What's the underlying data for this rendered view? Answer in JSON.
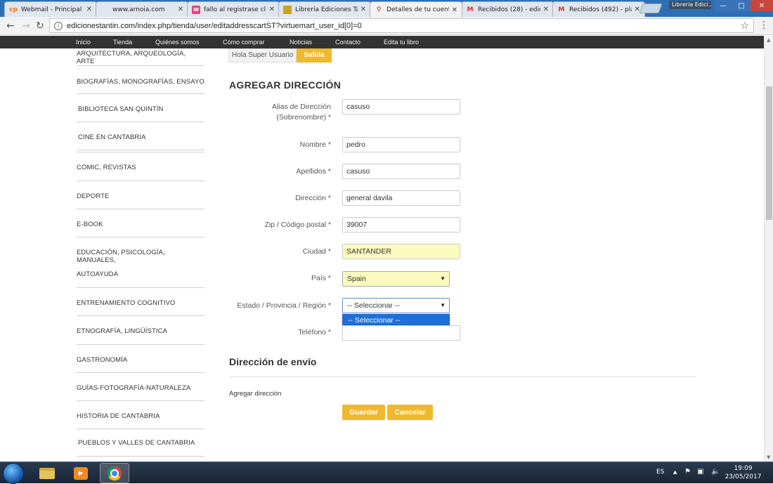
{
  "browser": {
    "tabs": [
      {
        "label": "Webmail - Principal",
        "favicon": "cp"
      },
      {
        "label": "www.arnoia.com",
        "favicon": ""
      },
      {
        "label": "fallo al registrase cl",
        "favicon": "w"
      },
      {
        "label": "Librería Ediciones Ta",
        "favicon": "sq"
      },
      {
        "label": "Detalles de tu cuent",
        "favicon": "pin"
      },
      {
        "label": "Recibidos (28) - edic",
        "favicon": "M"
      },
      {
        "label": "Recibidos (492) - pla",
        "favicon": "M"
      }
    ],
    "profile": "Libreria Edici...",
    "url": "edicionestantin.com/index.php/tienda/user/editaddresscartST?virtuemart_user_id[0]=0"
  },
  "site_nav": [
    "Inicio",
    "Tienda",
    "Quiénes somos",
    "Cómo comprar",
    "Noticias",
    "Contacto",
    "Edita tu libro"
  ],
  "categories": [
    "ARQUITECTURA, ARQUEOLOGÍA, ARTE",
    "BIOGRAFÍAS, MONOGRAFÍAS, ENSAYO",
    "BIBLIOTECA SAN QUINTÍN",
    "CINE EN CANTABRIA",
    "CÓMIC, REVISTAS",
    "DEPORTE",
    "E-BOOK",
    "EDUCACIÓN, PSICOLOGÍA, MANUALES,",
    "AUTOAYUDA",
    "ENTRENAMIENTO COGNITIVO",
    "ETNOGRAFÍA, LINGÜÍSTICA",
    "GASTRONOMÍA",
    "GUÍAS-FOTOGRAFÍA-NATURALEZA",
    "HISTORIA DE CANTABRIA",
    "PUEBLOS Y VALLES DE CANTABRIA"
  ],
  "user": {
    "greeting": "Hola Super Usuario",
    "logout_label": "Salida"
  },
  "form": {
    "title": "AGREGAR DIRECCIÓN",
    "alias_label_1": "Alias de Dirección",
    "alias_label_2": "(Sobrenombre) *",
    "alias_value": "casuso",
    "nombre_label": "Nombre *",
    "nombre_value": "pedro",
    "apellidos_label": "Apellidos *",
    "apellidos_value": "casuso",
    "direccion_label": "Dirección *",
    "direccion_value": "general davila",
    "zip_label": "Zip / Código postal *",
    "zip_value": "39007",
    "ciudad_label": "Ciudad *",
    "ciudad_value": "SANTANDER",
    "pais_label": "País *",
    "pais_value": "Spain",
    "region_label": "Estado / Provincia / Región *",
    "region_value": "-- Seleccionar --",
    "region_options": [
      "-- Seleccionar --"
    ],
    "telefono_label": "Teléfono *",
    "telefono_value": ""
  },
  "shipping": {
    "title": "Dirección de envío",
    "add_label": "Agregar dirección"
  },
  "buttons": {
    "save": "Guardar",
    "cancel": "Cancelar"
  },
  "taskbar": {
    "lang": "ES",
    "time": "19:09",
    "date": "23/05/2017"
  },
  "colors": {
    "accent": "#f0b82d",
    "nav_bg": "#333333",
    "autofill": "#fbfbc0",
    "select_highlight": "#1e6fd9"
  }
}
